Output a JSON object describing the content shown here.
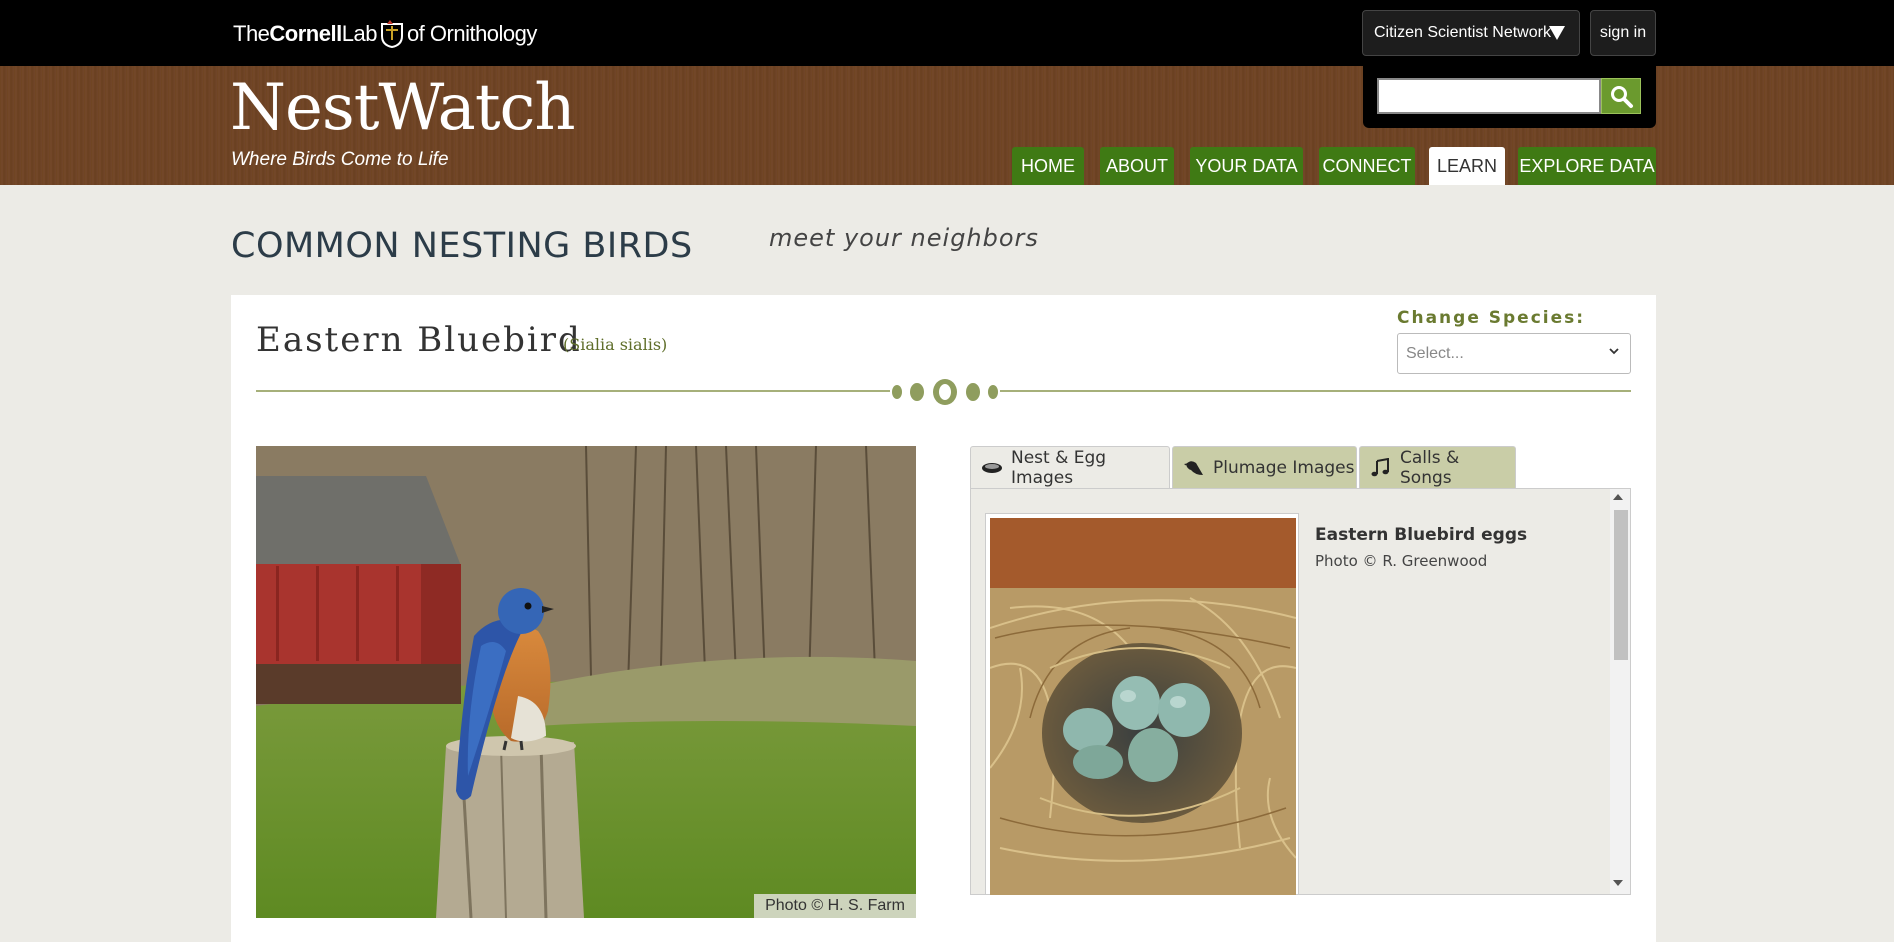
{
  "topbar": {
    "logo": {
      "the": "The",
      "cornell": "Cornell",
      "lab": "Lab",
      "of": "of Ornithology"
    },
    "network_button": "Citizen Scientist Network",
    "signin_button": "sign in"
  },
  "header": {
    "brand": "NestWatch",
    "tagline": "Where Birds Come to Life",
    "search": {
      "placeholder": "",
      "value": ""
    }
  },
  "nav": [
    {
      "label": "HOME",
      "active": false
    },
    {
      "label": "ABOUT",
      "active": false
    },
    {
      "label": "YOUR DATA",
      "active": false
    },
    {
      "label": "CONNECT",
      "active": false
    },
    {
      "label": "LEARN",
      "active": true
    },
    {
      "label": "EXPLORE DATA",
      "active": false
    }
  ],
  "page": {
    "title": "COMMON NESTING BIRDS",
    "subtitle": "meet your neighbors"
  },
  "species": {
    "common_name": "Eastern Bluebird",
    "scientific_name": "(Sialia sialis)",
    "change_label": "Change Species:",
    "select_value": "Select..."
  },
  "main_photo": {
    "credit": "Photo © H. S. Farm"
  },
  "tabs": [
    {
      "label": "Nest & Egg Images",
      "icon": "nest-icon",
      "active": true
    },
    {
      "label": "Plumage Images",
      "icon": "bird-icon",
      "active": false
    },
    {
      "label": "Calls & Songs",
      "icon": "music-note-icon",
      "active": false
    }
  ],
  "gallery": {
    "caption_title": "Eastern Bluebird eggs",
    "caption_credit": "Photo © R. Greenwood"
  },
  "colors": {
    "nav_green": "#3f7a14",
    "header_brown": "#6e4421",
    "search_green": "#6b9a2e",
    "tab_inactive": "#c9cda7"
  }
}
